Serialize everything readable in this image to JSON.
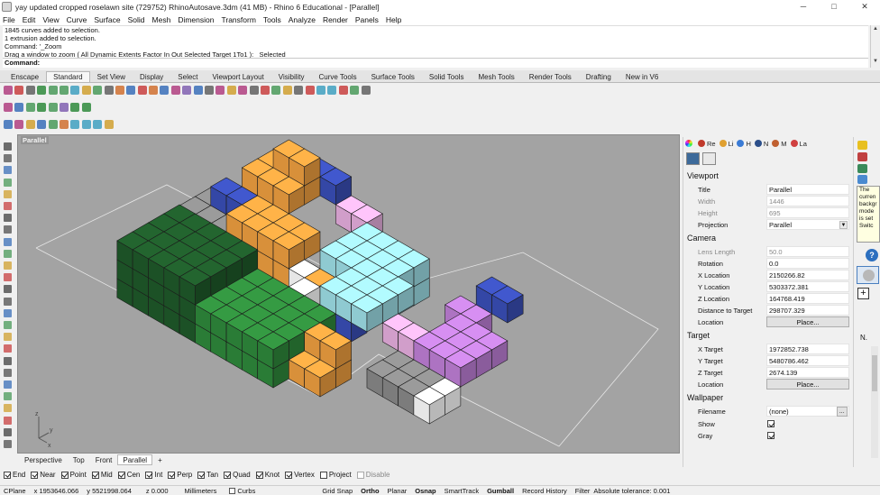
{
  "window": {
    "title": "yay updated cropped roselawn site (729752) RhinoAutosave.3dm (41 MB) - Rhino 6 Educational - [Parallel]",
    "minimize": "─",
    "maximize": "□",
    "close": "✕"
  },
  "menu": [
    "File",
    "Edit",
    "View",
    "Curve",
    "Surface",
    "Solid",
    "Mesh",
    "Dimension",
    "Transform",
    "Tools",
    "Analyze",
    "Render",
    "Panels",
    "Help"
  ],
  "command_history": [
    "1845 curves added to selection.",
    "1 extrusion added to selection.",
    "Command: '_Zoom",
    "Drag a window to zoom ( All  Dynamic  Extents  Factor  In  Out  Selected  Target  1To1 ): _Selected"
  ],
  "command_prompt": "Command:",
  "toolbar_tabs": [
    {
      "label": "Enscape",
      "active": false
    },
    {
      "label": "Standard",
      "active": true
    },
    {
      "label": "Set View",
      "active": false
    },
    {
      "label": "Display",
      "active": false
    },
    {
      "label": "Select",
      "active": false
    },
    {
      "label": "Viewport Layout",
      "active": false
    },
    {
      "label": "Visibility",
      "active": false
    },
    {
      "label": "Curve Tools",
      "active": false
    },
    {
      "label": "Surface Tools",
      "active": false
    },
    {
      "label": "Solid Tools",
      "active": false
    },
    {
      "label": "Mesh Tools",
      "active": false
    },
    {
      "label": "Render Tools",
      "active": false
    },
    {
      "label": "Drafting",
      "active": false
    },
    {
      "label": "New in V6",
      "active": false
    }
  ],
  "toolbar_icons_row1": [
    "new-icon",
    "open-icon",
    "save-icon",
    "print-icon",
    "import-icon",
    "cut-icon",
    "copy-icon",
    "paste-icon",
    "undo-icon",
    "pan-icon",
    "rotate-view-icon",
    "zoom-dynamic-icon",
    "zoom-window-icon",
    "zoom-extents-icon",
    "zoom-selected-icon",
    "zoom-all-icon",
    "zoom-target-icon",
    "grid-icon",
    "cplane-icon",
    "lights-icon",
    "layers-icon",
    "properties-icon",
    "lock-icon",
    "material-icon",
    "render-icon",
    "environment-icon",
    "display-mode-icon",
    "shaded-icon",
    "rendered-icon",
    "toolbar-options-icon",
    "analyze-icon",
    "globe-icon",
    "help-icon"
  ],
  "toolbar_icons_row2": [
    "enscape-start-icon",
    "enscape-sync-icon",
    "enscape-view-icon",
    "enscape-capture-icon",
    "enscape-settings-icon",
    "enscape-assets-icon",
    "enscape-feedback-icon",
    "enscape-about-icon"
  ],
  "toolbar_icons_row3": [
    "check-icon",
    "shape-tool-icon",
    "curve-tool-icon",
    "window-icon",
    "filter-icon",
    "cursor-icon",
    "move-icon",
    "object-snap-icon",
    "cylinder-icon",
    "grid-snap-icon"
  ],
  "viewport": {
    "label": "Parallel",
    "axis_x": "x",
    "axis_y": "y",
    "axis_z": "z"
  },
  "viewport_tabs": [
    {
      "label": "Perspective",
      "active": false
    },
    {
      "label": "Top",
      "active": false
    },
    {
      "label": "Front",
      "active": false
    },
    {
      "label": "Parallel",
      "active": true
    },
    {
      "label": "+",
      "active": false
    }
  ],
  "osnaps": [
    {
      "label": "End",
      "checked": true,
      "enabled": true
    },
    {
      "label": "Near",
      "checked": true,
      "enabled": true
    },
    {
      "label": "Point",
      "checked": true,
      "enabled": true
    },
    {
      "label": "Mid",
      "checked": true,
      "enabled": true
    },
    {
      "label": "Cen",
      "checked": true,
      "enabled": true
    },
    {
      "label": "Int",
      "checked": true,
      "enabled": true
    },
    {
      "label": "Perp",
      "checked": true,
      "enabled": true
    },
    {
      "label": "Tan",
      "checked": true,
      "enabled": true
    },
    {
      "label": "Quad",
      "checked": true,
      "enabled": true
    },
    {
      "label": "Knot",
      "checked": true,
      "enabled": true
    },
    {
      "label": "Vertex",
      "checked": true,
      "enabled": true
    },
    {
      "label": "Project",
      "checked": false,
      "enabled": true
    },
    {
      "label": "Disable",
      "checked": false,
      "enabled": false
    }
  ],
  "status": {
    "cplane": "CPlane",
    "x": "x 1953646.066",
    "y": "y 5521998.064",
    "z": "z 0.000",
    "units": "Millimeters",
    "layer": "Curbs",
    "grid_snap": "Grid Snap",
    "ortho": "Ortho",
    "planar": "Planar",
    "osnap": "Osnap",
    "smarttrack": "SmartTrack",
    "gumball": "Gumball",
    "record_history": "Record History",
    "filter": "Filter",
    "tolerance": "Absolute tolerance: 0.001"
  },
  "properties_tabs": [
    {
      "label": "Re",
      "color": "#c0392b"
    },
    {
      "label": "Li",
      "color": "#e0a030"
    },
    {
      "label": "H",
      "color": "#3a7bd5"
    },
    {
      "label": "N",
      "color": "#2c4f8a"
    },
    {
      "label": "M",
      "color": "#c06030"
    },
    {
      "label": "La",
      "color": "#d04040"
    }
  ],
  "properties": {
    "viewport_section": "Viewport",
    "title_label": "Title",
    "title_value": "Parallel",
    "width_label": "Width",
    "width_value": "1446",
    "height_label": "Height",
    "height_value": "695",
    "projection_label": "Projection",
    "projection_value": "Parallel",
    "camera_section": "Camera",
    "lens_label": "Lens Length",
    "lens_value": "50.0",
    "rotation_label": "Rotation",
    "rotation_value": "0.0",
    "xloc_label": "X Location",
    "xloc_value": "2150266.82",
    "yloc_label": "Y Location",
    "yloc_value": "5303372.381",
    "zloc_label": "Z Location",
    "zloc_value": "164768.419",
    "dist_label": "Distance to Target",
    "dist_value": "298707.329",
    "camloc_label": "Location",
    "camloc_button": "Place...",
    "target_section": "Target",
    "xt_label": "X Target",
    "xt_value": "1972852.738",
    "yt_label": "Y Target",
    "yt_value": "5480786.462",
    "zt_label": "Z Target",
    "zt_value": "2674.139",
    "tloc_label": "Location",
    "tloc_button": "Place...",
    "wallpaper_section": "Wallpaper",
    "filename_label": "Filename",
    "filename_value": "(none)",
    "filename_button": "...",
    "show_label": "Show",
    "show_checked": true,
    "gray_label": "Gray",
    "gray_checked": true
  },
  "help_tip": [
    "The",
    "curren",
    "backgr",
    "mode",
    "is set",
    "Switc"
  ],
  "right_label": "N.",
  "colors": {
    "viewport_bg": "#a3a3a3",
    "dark_green": "#1f5a2a",
    "green": "#2f8a3c",
    "orange": "#f0a040",
    "blue": "#3a4fb8",
    "cyan": "#9fe0e8",
    "purple": "#c080d8",
    "pink": "#e8b0e0",
    "gray": "#8a8a8a",
    "white": "#ffffff"
  }
}
